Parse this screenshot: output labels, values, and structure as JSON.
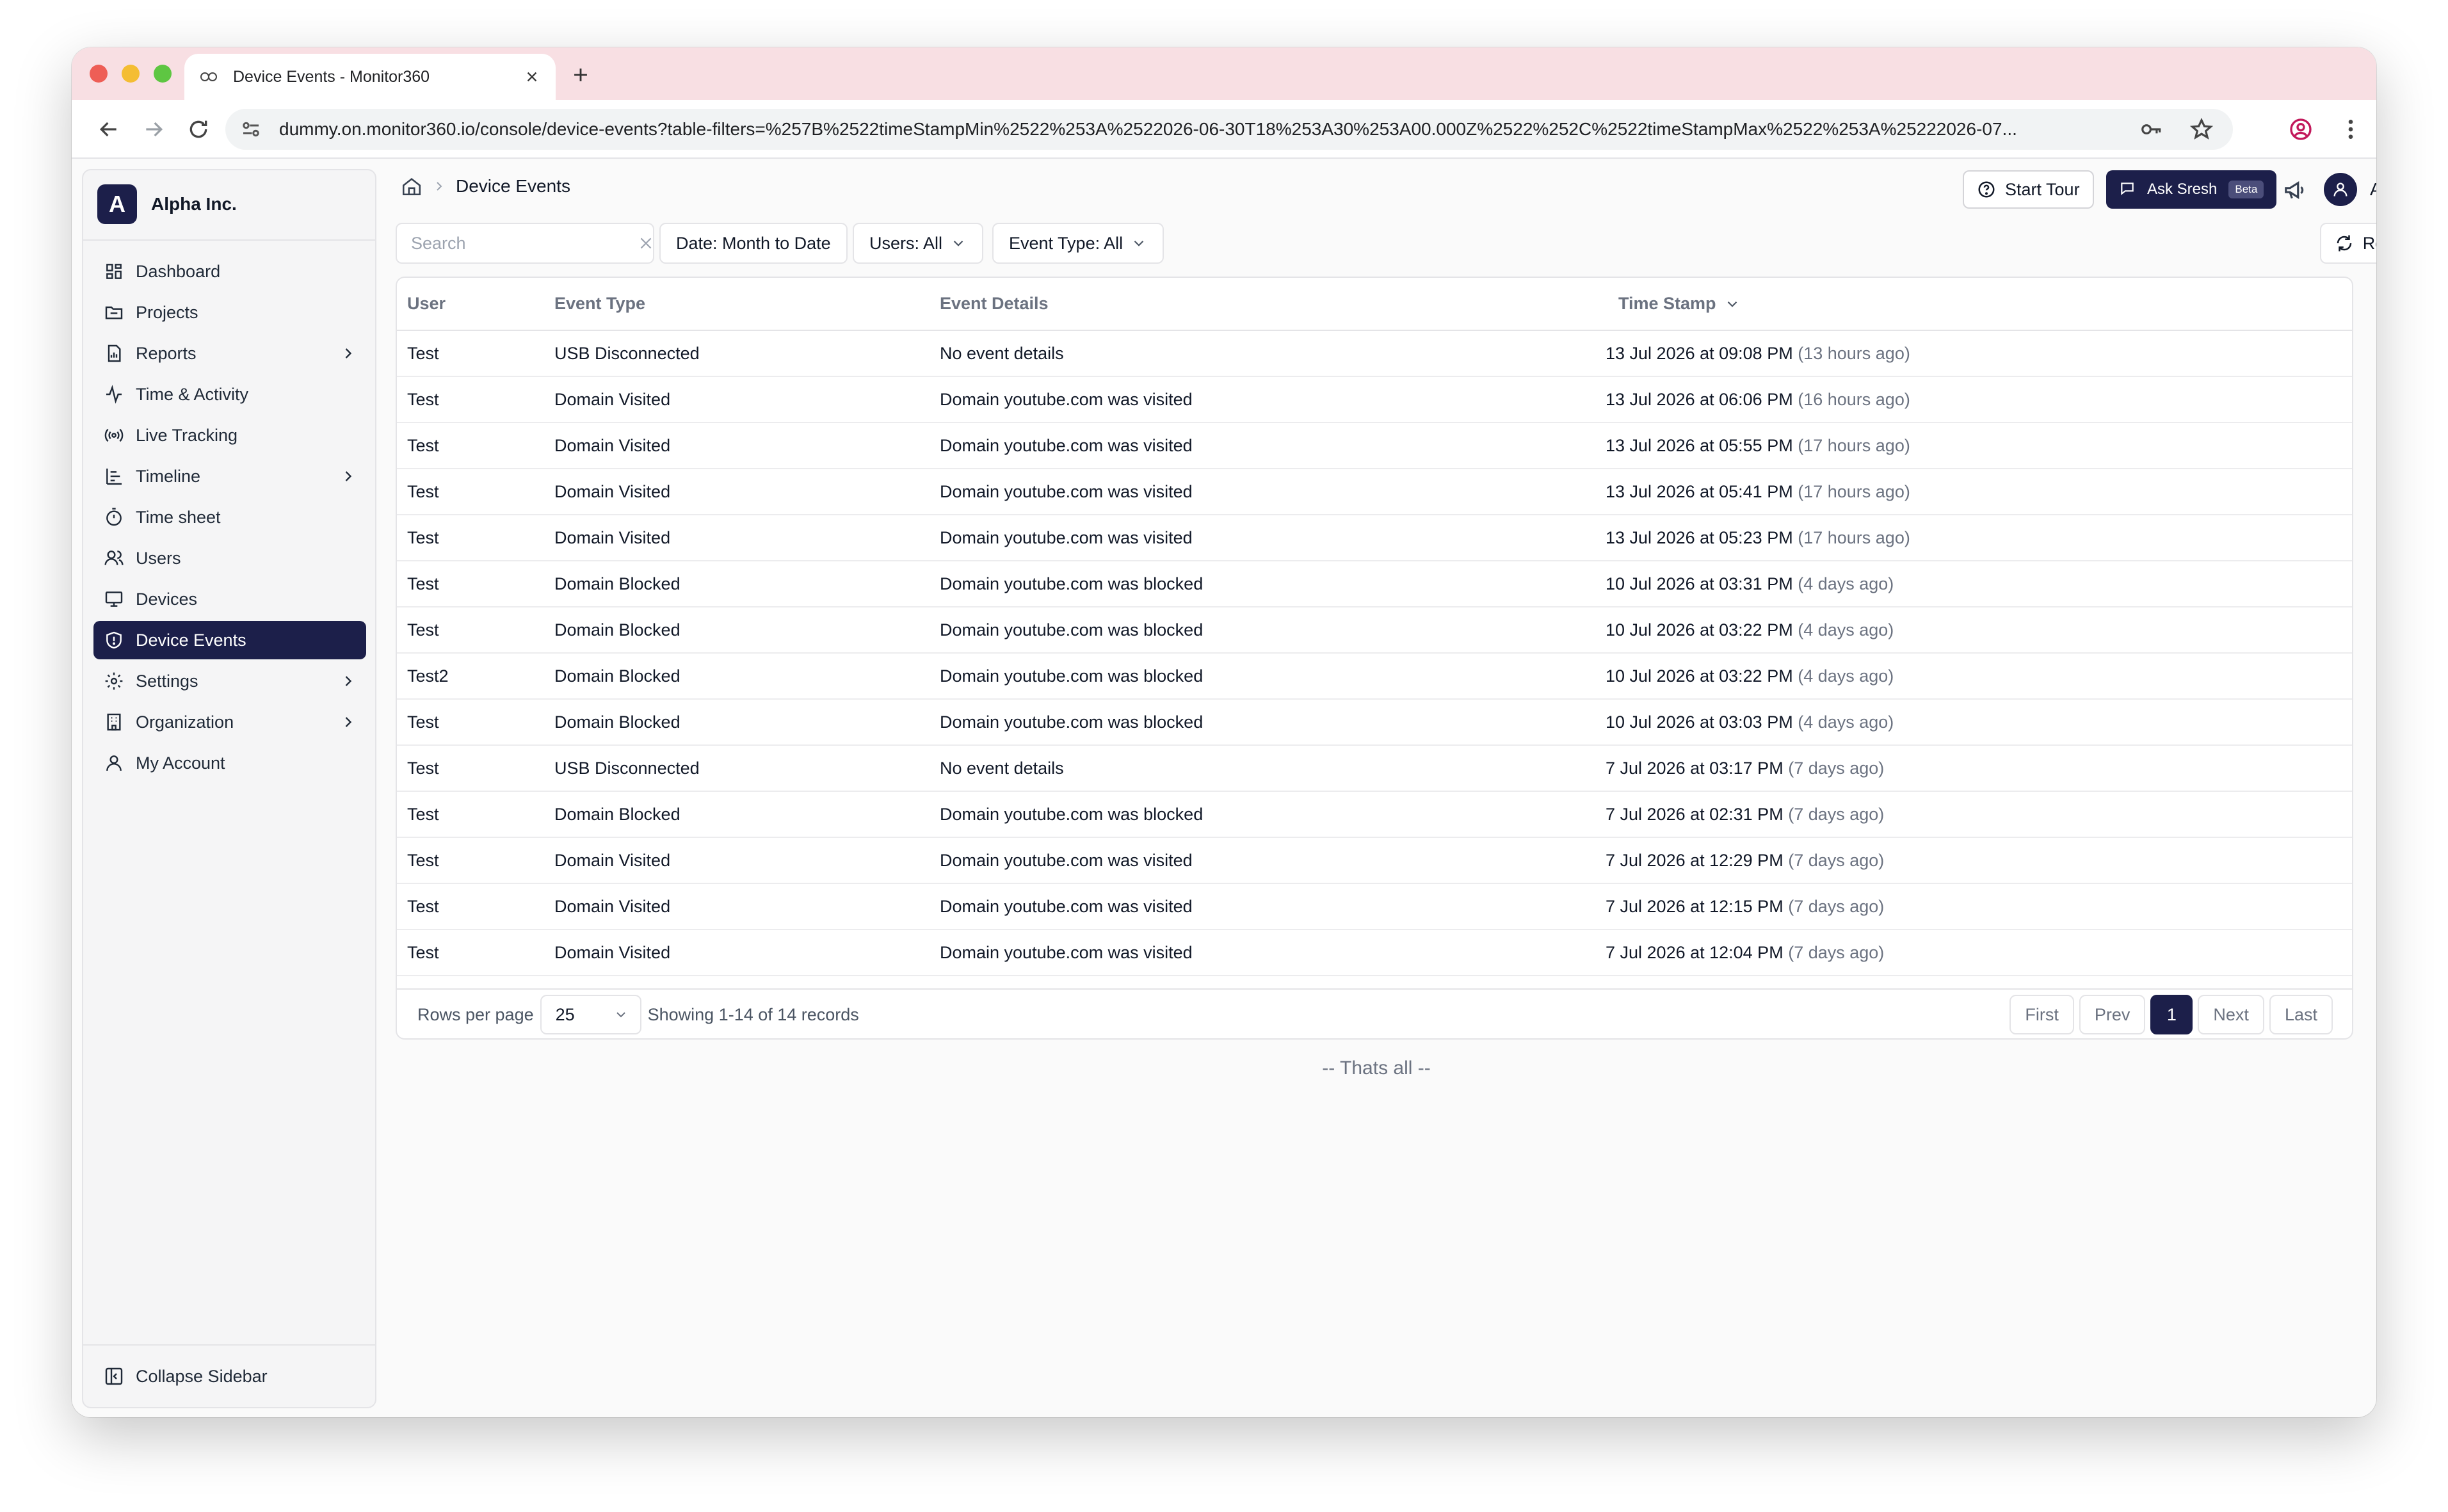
{
  "browser": {
    "tab_title": "Device Events - Monitor360",
    "url": "dummy.on.monitor360.io/console/device-events?table-filters=%257B%2522timeStampMin%2522%253A%2522026-06-30T18%253A30%253A00.000Z%2522%252C%2522timeStampMax%2522%253A%25222026-07..."
  },
  "sidebar": {
    "brand_initial": "A",
    "brand_name": "Alpha Inc.",
    "items": [
      {
        "label": "Dashboard",
        "icon": "dashboard-icon",
        "has_submenu": false,
        "active": false
      },
      {
        "label": "Projects",
        "icon": "folder-icon",
        "has_submenu": false,
        "active": false
      },
      {
        "label": "Reports",
        "icon": "report-icon",
        "has_submenu": true,
        "active": false
      },
      {
        "label": "Time & Activity",
        "icon": "activity-icon",
        "has_submenu": false,
        "active": false
      },
      {
        "label": "Live Tracking",
        "icon": "broadcast-icon",
        "has_submenu": false,
        "active": false
      },
      {
        "label": "Timeline",
        "icon": "timeline-icon",
        "has_submenu": true,
        "active": false
      },
      {
        "label": "Time sheet",
        "icon": "timer-icon",
        "has_submenu": false,
        "active": false
      },
      {
        "label": "Users",
        "icon": "users-icon",
        "has_submenu": false,
        "active": false
      },
      {
        "label": "Devices",
        "icon": "monitor-icon",
        "has_submenu": false,
        "active": false
      },
      {
        "label": "Device Events",
        "icon": "shield-icon",
        "has_submenu": false,
        "active": true
      },
      {
        "label": "Settings",
        "icon": "gear-icon",
        "has_submenu": true,
        "active": false
      },
      {
        "label": "Organization",
        "icon": "building-icon",
        "has_submenu": true,
        "active": false
      },
      {
        "label": "My Account",
        "icon": "user-icon",
        "has_submenu": false,
        "active": false
      }
    ],
    "collapse_label": "Collapse Sidebar"
  },
  "header": {
    "breadcrumb_current": "Device Events",
    "start_tour_label": "Start Tour",
    "ask_label": "Ask Sresh",
    "beta_label": "Beta",
    "admin_label": "Admin"
  },
  "filters": {
    "search_placeholder": "Search",
    "date_label": "Date: Month to Date",
    "users_label": "Users: All",
    "event_type_label": "Event Type: All",
    "refresh_label": "Refresh"
  },
  "table": {
    "columns": [
      "User",
      "Event Type",
      "Event Details",
      "Time Stamp"
    ],
    "rows": [
      {
        "user": "Test",
        "event_type": "USB Disconnected",
        "details": "No event details",
        "timestamp": "13 Jul 2026 at 09:08 PM",
        "ago": "(13 hours ago)"
      },
      {
        "user": "Test",
        "event_type": "Domain Visited",
        "details": "Domain youtube.com was visited",
        "timestamp": "13 Jul 2026 at 06:06 PM",
        "ago": "(16 hours ago)"
      },
      {
        "user": "Test",
        "event_type": "Domain Visited",
        "details": "Domain youtube.com was visited",
        "timestamp": "13 Jul 2026 at 05:55 PM",
        "ago": "(17 hours ago)"
      },
      {
        "user": "Test",
        "event_type": "Domain Visited",
        "details": "Domain youtube.com was visited",
        "timestamp": "13 Jul 2026 at 05:41 PM",
        "ago": "(17 hours ago)"
      },
      {
        "user": "Test",
        "event_type": "Domain Visited",
        "details": "Domain youtube.com was visited",
        "timestamp": "13 Jul 2026 at 05:23 PM",
        "ago": "(17 hours ago)"
      },
      {
        "user": "Test",
        "event_type": "Domain Blocked",
        "details": "Domain youtube.com was blocked",
        "timestamp": "10 Jul 2026 at 03:31 PM",
        "ago": "(4 days ago)"
      },
      {
        "user": "Test",
        "event_type": "Domain Blocked",
        "details": "Domain youtube.com was blocked",
        "timestamp": "10 Jul 2026 at 03:22 PM",
        "ago": "(4 days ago)"
      },
      {
        "user": "Test2",
        "event_type": "Domain Blocked",
        "details": "Domain youtube.com was blocked",
        "timestamp": "10 Jul 2026 at 03:22 PM",
        "ago": "(4 days ago)"
      },
      {
        "user": "Test",
        "event_type": "Domain Blocked",
        "details": "Domain youtube.com was blocked",
        "timestamp": "10 Jul 2026 at 03:03 PM",
        "ago": "(4 days ago)"
      },
      {
        "user": "Test",
        "event_type": "USB Disconnected",
        "details": "No event details",
        "timestamp": "7 Jul 2026 at 03:17 PM",
        "ago": "(7 days ago)"
      },
      {
        "user": "Test",
        "event_type": "Domain Blocked",
        "details": "Domain youtube.com was blocked",
        "timestamp": "7 Jul 2026 at 02:31 PM",
        "ago": "(7 days ago)"
      },
      {
        "user": "Test",
        "event_type": "Domain Visited",
        "details": "Domain youtube.com was visited",
        "timestamp": "7 Jul 2026 at 12:29 PM",
        "ago": "(7 days ago)"
      },
      {
        "user": "Test",
        "event_type": "Domain Visited",
        "details": "Domain youtube.com was visited",
        "timestamp": "7 Jul 2026 at 12:15 PM",
        "ago": "(7 days ago)"
      },
      {
        "user": "Test",
        "event_type": "Domain Visited",
        "details": "Domain youtube.com was visited",
        "timestamp": "7 Jul 2026 at 12:04 PM",
        "ago": "(7 days ago)"
      }
    ]
  },
  "pagination": {
    "rows_per_page_label": "Rows per page",
    "rows_per_page_value": "25",
    "showing_text": "Showing 1-14 of 14 records",
    "first_label": "First",
    "prev_label": "Prev",
    "current_page": "1",
    "next_label": "Next",
    "last_label": "Last"
  },
  "end_message": "-- Thats all --",
  "colors": {
    "primary": "#1c1f4a",
    "tabbar": "#f8dfe3",
    "muted_text": "#6b7280"
  }
}
